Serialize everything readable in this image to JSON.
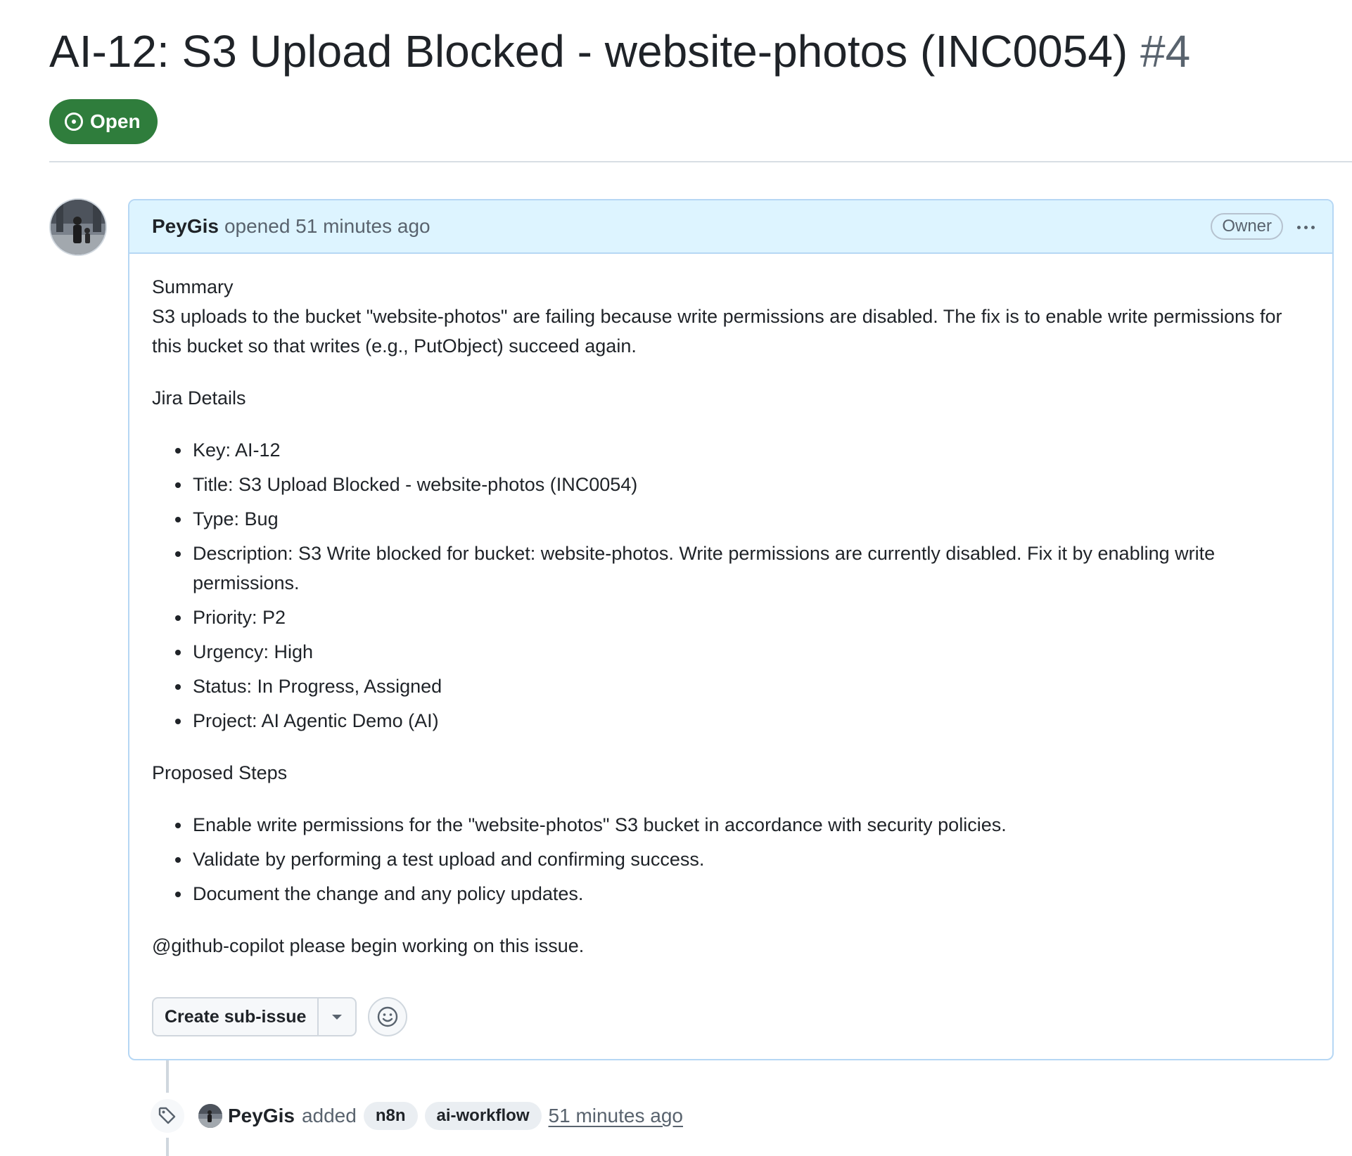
{
  "issue": {
    "title": "AI-12: S3 Upload Blocked - website-photos (INC0054)",
    "number": "#4",
    "state": "Open",
    "state_color": "#2f7d3c"
  },
  "comment": {
    "author": "PeyGis",
    "action": "opened 51 minutes ago",
    "role_badge": "Owner",
    "summary_heading": "Summary",
    "summary_text": "S3 uploads to the bucket \"website-photos\" are failing because write permissions are disabled. The fix is to enable write permissions for this bucket so that writes (e.g., PutObject) succeed again.",
    "jira_heading": "Jira Details",
    "jira_items": [
      "Key: AI-12",
      "Title: S3 Upload Blocked - website-photos (INC0054)",
      "Type: Bug",
      "Description: S3 Write blocked for bucket: website-photos. Write permissions are currently disabled. Fix it by enabling write permissions.",
      "Priority: P2",
      "Urgency: High",
      "Status: In Progress, Assigned",
      "Project: AI Agentic Demo (AI)"
    ],
    "steps_heading": "Proposed Steps",
    "steps_items": [
      "Enable write permissions for the \"website-photos\" S3 bucket in accordance with security policies.",
      "Validate by performing a test upload and confirming success.",
      "Document the change and any policy updates."
    ],
    "mention_text": "@github-copilot please begin working on this issue.",
    "create_sub_issue_label": "Create sub-issue"
  },
  "timeline_event": {
    "author": "PeyGis",
    "action": "added",
    "labels": [
      "n8n",
      "ai-workflow"
    ],
    "time": "51 minutes ago"
  }
}
